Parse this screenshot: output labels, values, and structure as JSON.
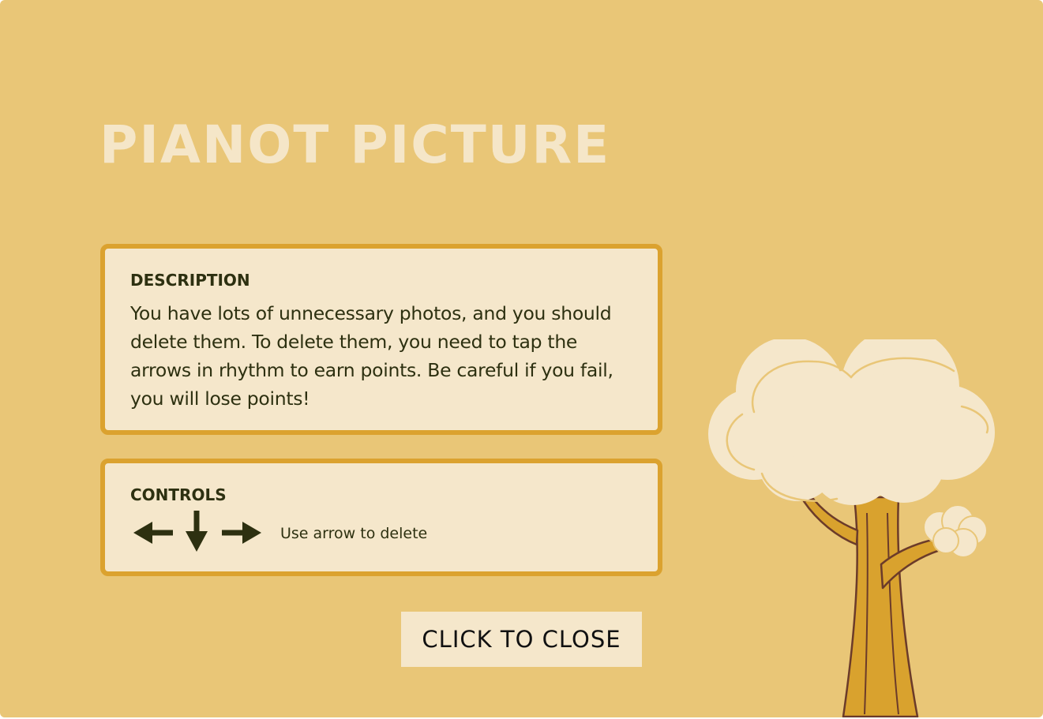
{
  "game_title": "PIANOT PICTURE",
  "description": {
    "heading": "DESCRIPTION",
    "text": "You have lots of unnecessary photos, and you should delete them. To delete them, you need to tap the arrows in rhythm to earn points. Be careful if you fail, you will lose points!"
  },
  "controls": {
    "heading": "CONTROLS",
    "icons": [
      "arrow-left-icon",
      "arrow-down-icon",
      "arrow-right-icon"
    ],
    "hint": "Use arrow to delete"
  },
  "close_button": {
    "label": "CLICK TO CLOSE"
  },
  "colors": {
    "background": "#e9c677",
    "panel_fill": "#f5e7cb",
    "panel_border": "#dba22f",
    "title_text": "#f5e6c8",
    "body_text": "#2d3010",
    "tree_trunk": "#d9a22e",
    "tree_outline": "#6b3b2a",
    "tree_canopy": "#f5e7cb"
  }
}
